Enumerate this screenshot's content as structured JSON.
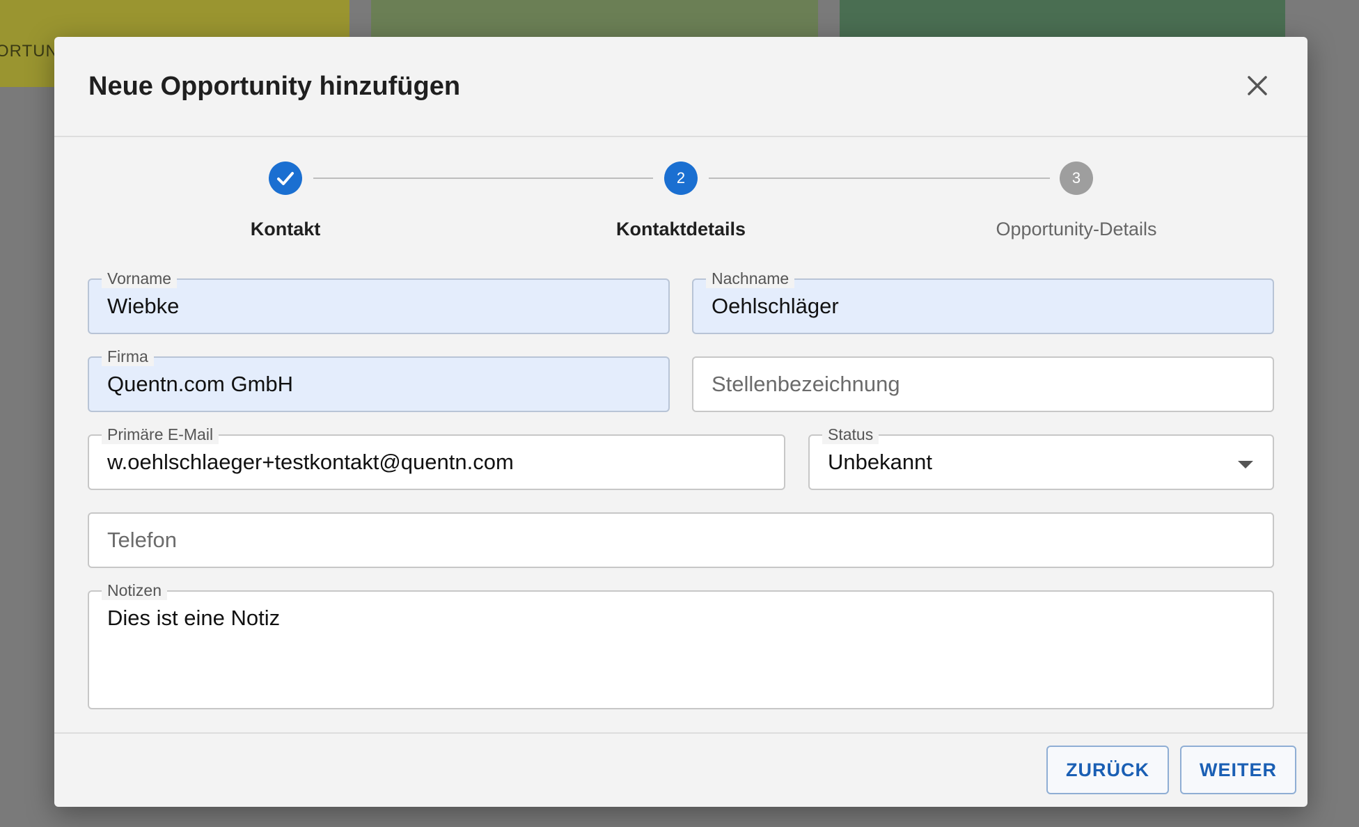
{
  "background": {
    "column_label": "ORTUN",
    "colors": [
      "#9a9530",
      "#6b7f55",
      "#4a6e52"
    ]
  },
  "dialog": {
    "title": "Neue Opportunity hinzufügen",
    "close_icon": "close-icon"
  },
  "stepper": {
    "steps": [
      {
        "number": "1",
        "label": "Kontakt",
        "state": "done",
        "icon": "check-icon"
      },
      {
        "number": "2",
        "label": "Kontaktdetails",
        "state": "active"
      },
      {
        "number": "3",
        "label": "Opportunity-Details",
        "state": "pending"
      }
    ]
  },
  "form": {
    "vorname": {
      "label": "Vorname",
      "value": "Wiebke"
    },
    "nachname": {
      "label": "Nachname",
      "value": "Oehlschläger"
    },
    "firma": {
      "label": "Firma",
      "value": "Quentn.com GmbH"
    },
    "stellenbezeichnung": {
      "placeholder": "Stellenbezeichnung"
    },
    "email": {
      "label": "Primäre E-Mail",
      "value": "w.oehlschlaeger+testkontakt@quentn.com"
    },
    "status": {
      "label": "Status",
      "value": "Unbekannt",
      "icon": "chevron-down-icon"
    },
    "telefon": {
      "placeholder": "Telefon"
    },
    "notizen": {
      "label": "Notizen",
      "value": "Dies ist eine Notiz"
    }
  },
  "footer": {
    "back_label": "ZURÜCK",
    "next_label": "WEITER"
  },
  "colors": {
    "accent": "#1a6fd1",
    "pending": "#9e9e9e",
    "filled_field": "#e4edfc"
  }
}
